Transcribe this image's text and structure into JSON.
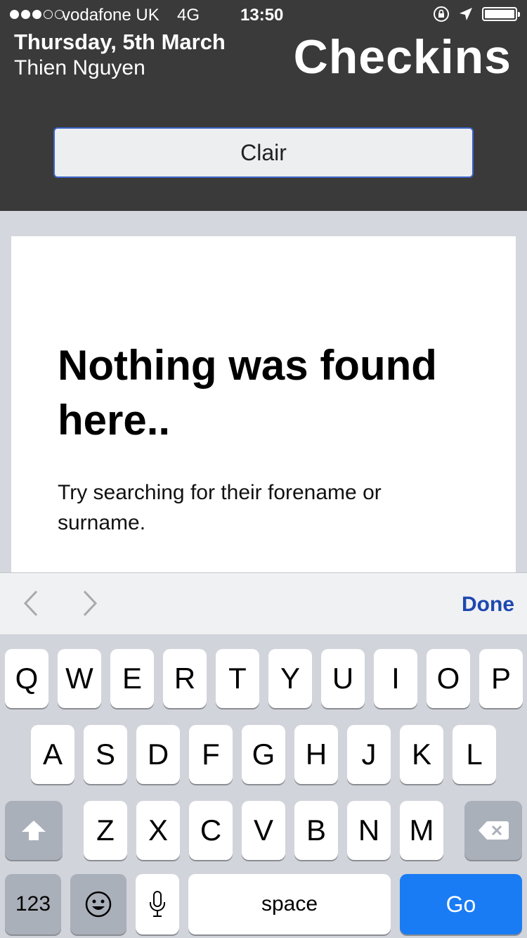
{
  "status_bar": {
    "carrier": "vodafone UK",
    "network": "4G",
    "time": "13:50"
  },
  "header": {
    "date": "Thursday, 5th March",
    "user": "Thien Nguyen",
    "title": "Checkins"
  },
  "search": {
    "value": "Clair"
  },
  "empty_state": {
    "title": "Nothing was found here..",
    "body": "Try searching for their forename or surname."
  },
  "accessory_bar": {
    "done_label": "Done"
  },
  "keyboard": {
    "row1": [
      "Q",
      "W",
      "E",
      "R",
      "T",
      "Y",
      "U",
      "I",
      "O",
      "P"
    ],
    "row2": [
      "A",
      "S",
      "D",
      "F",
      "G",
      "H",
      "J",
      "K",
      "L"
    ],
    "row3": [
      "Z",
      "X",
      "C",
      "V",
      "B",
      "N",
      "M"
    ],
    "numbers_label": "123",
    "space_label": "space",
    "go_label": "Go"
  },
  "colors": {
    "header_bg": "#3a3a3a",
    "accent": "#1a7cf4",
    "done": "#1e48b0"
  },
  "icons": [
    "signal-dots-icon",
    "orientation-lock-icon",
    "location-arrow-icon",
    "battery-icon",
    "chevron-left-icon",
    "chevron-right-icon",
    "shift-icon",
    "backspace-icon",
    "emoji-icon",
    "microphone-icon"
  ]
}
